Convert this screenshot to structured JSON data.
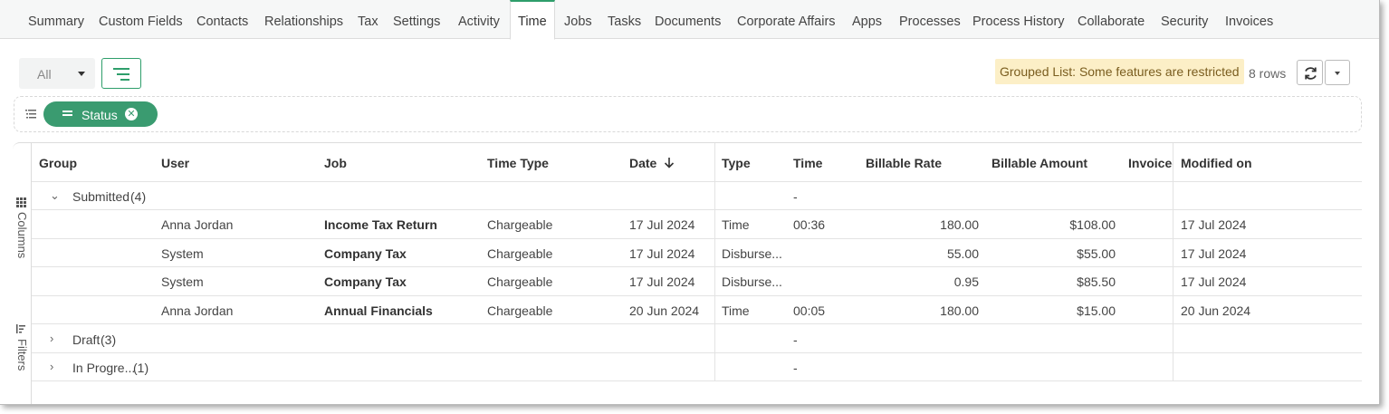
{
  "tabs": [
    "Summary",
    "Custom Fields",
    "Contacts",
    "Relationships",
    "Tax",
    "Settings",
    "Activity",
    "Time",
    "Jobs",
    "Tasks",
    "Documents",
    "Corporate Affairs",
    "Apps",
    "Processes",
    "Process History",
    "Collaborate",
    "Security",
    "Invoices"
  ],
  "active_tab": "Time",
  "toolbar": {
    "filter_value": "All",
    "restricted_notice": "Grouped List: Some features are restricted",
    "row_count": "8 rows"
  },
  "group_by": {
    "chip_label": "Status"
  },
  "side_panel": {
    "columns_label": "Columns",
    "filters_label": "Filters"
  },
  "columns": [
    "Group",
    "User",
    "Job",
    "Time Type",
    "Date",
    "Type",
    "Time",
    "Billable Rate",
    "Billable Amount",
    "Invoiced",
    "Modified on"
  ],
  "groups": [
    {
      "label": "Submitted",
      "count": "(4)",
      "time": "-",
      "expanded": true
    },
    {
      "label": "Draft",
      "count": "(3)",
      "time": "-",
      "expanded": false
    },
    {
      "label": "In Progre...",
      "count": "(1)",
      "time": "-",
      "expanded": false
    }
  ],
  "rows": [
    {
      "user": "Anna Jordan",
      "job": "Income Tax Return",
      "time_type": "Chargeable",
      "date": "17 Jul 2024",
      "type": "Time",
      "time": "00:36",
      "rate": "180.00",
      "amount": "$108.00",
      "invoiced": "",
      "modified": "17 Jul 2024"
    },
    {
      "user": "System",
      "job": "Company Tax",
      "time_type": "Chargeable",
      "date": "17 Jul 2024",
      "type": "Disburse...",
      "time": "",
      "rate": "55.00",
      "amount": "$55.00",
      "invoiced": "",
      "modified": "17 Jul 2024"
    },
    {
      "user": "System",
      "job": "Company Tax",
      "time_type": "Chargeable",
      "date": "17 Jul 2024",
      "type": "Disburse...",
      "time": "",
      "rate": "0.95",
      "amount": "$85.50",
      "invoiced": "",
      "modified": "17 Jul 2024"
    },
    {
      "user": "Anna Jordan",
      "job": "Annual Financials",
      "time_type": "Chargeable",
      "date": "20 Jun 2024",
      "type": "Time",
      "time": "00:05",
      "rate": "180.00",
      "amount": "$15.00",
      "invoiced": "",
      "modified": "20 Jun 2024"
    }
  ],
  "colors": {
    "accent": "#2e9e6b",
    "chip": "#3a9b70",
    "notice_bg": "#fcefc7"
  }
}
